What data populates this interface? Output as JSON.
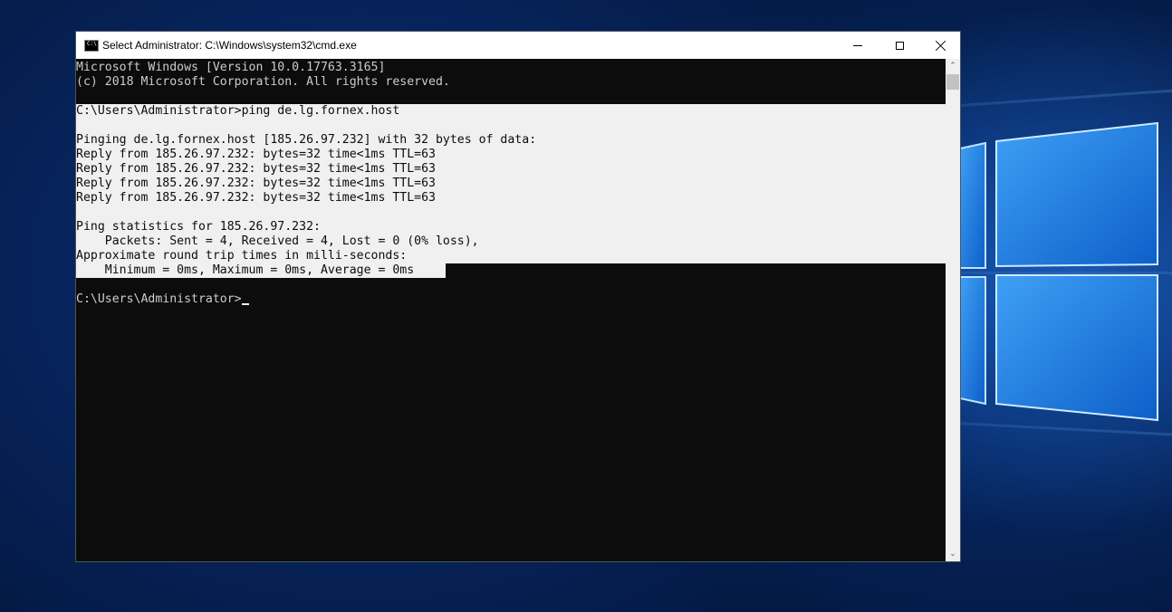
{
  "window": {
    "title": "Select Administrator: C:\\Windows\\system32\\cmd.exe",
    "icon_label": "C:\\",
    "controls": {
      "minimize": "minimize-icon",
      "maximize": "maximize-icon",
      "close": "close-icon"
    }
  },
  "console": {
    "lines": [
      "Microsoft Windows [Version 10.0.17763.3165]",
      "(c) 2018 Microsoft Corporation. All rights reserved.",
      "",
      "C:\\Users\\Administrator>ping de.lg.fornex.host",
      "",
      "Pinging de.lg.fornex.host [185.26.97.232] with 32 bytes of data:",
      "Reply from 185.26.97.232: bytes=32 time<1ms TTL=63",
      "Reply from 185.26.97.232: bytes=32 time<1ms TTL=63",
      "Reply from 185.26.97.232: bytes=32 time<1ms TTL=63",
      "Reply from 185.26.97.232: bytes=32 time<1ms TTL=63",
      "",
      "Ping statistics for 185.26.97.232:",
      "    Packets: Sent = 4, Received = 4, Lost = 0 (0% loss),",
      "Approximate round trip times in milli-seconds:",
      "    Minimum = 0ms, Maximum = 0ms, Average = 0ms",
      "",
      "C:\\Users\\Administrator>"
    ],
    "colors": {
      "background": "#0c0c0c",
      "text": "#cccccc",
      "selection": "#f0f0f0"
    }
  },
  "scrollbar": {
    "up_icon": "chevron-up-icon",
    "down_icon": "chevron-down-icon"
  },
  "desktop": {
    "logo": "windows-logo-icon"
  }
}
